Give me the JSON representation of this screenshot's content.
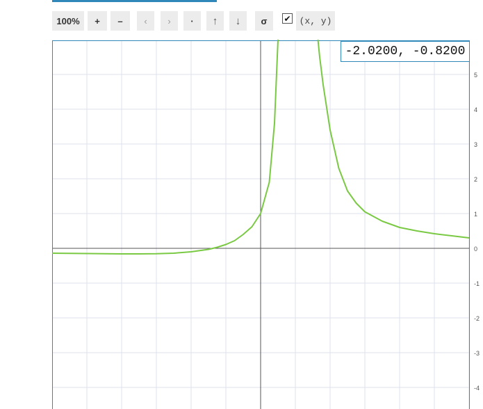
{
  "toolbar": {
    "zoom_label": "100%",
    "zoom_in_label": "+",
    "zoom_out_label": "–",
    "pan_left_label": "‹",
    "pan_right_label": "›",
    "center_label": "·",
    "pan_up_label": "↑",
    "pan_down_label": "↓",
    "trace_label": "σ",
    "coords_checked": true,
    "coords_check_mark": "✔",
    "coords_label": "(x, y)"
  },
  "readout": {
    "text": "-2.0200, -0.8200"
  },
  "chart_data": {
    "type": "line",
    "title": "",
    "xlabel": "",
    "ylabel": "",
    "xlim": [
      -6,
      6
    ],
    "ylim": [
      -4.5,
      6
    ],
    "grid": true,
    "x_tick_labels": [],
    "y_tick_labels": [
      "5",
      "4",
      "3",
      "2",
      "1",
      "0",
      "-1",
      "-2",
      "-3",
      "-4"
    ],
    "y_tick_values": [
      5,
      4,
      3,
      2,
      1,
      0,
      -1,
      -2,
      -3,
      -4
    ],
    "series": [
      {
        "color": "#7ac943",
        "segments": [
          {
            "x": [
              -6,
              -5,
              -4.5,
              -4,
              -3.5,
              -3,
              -2.5,
              -2,
              -1.5,
              -1.25,
              -1,
              -0.75,
              -0.5,
              -0.25,
              0,
              0.25,
              0.4,
              0.5
            ],
            "y": [
              -0.14,
              -0.15,
              -0.155,
              -0.16,
              -0.16,
              -0.155,
              -0.14,
              -0.1,
              -0.03,
              0.03,
              0.11,
              0.22,
              0.4,
              0.62,
              1,
              1.9,
              3.6,
              6
            ]
          },
          {
            "x": [
              1.65,
              1.7,
              1.8,
              2,
              2.25,
              2.5,
              2.75,
              3,
              3.5,
              4,
              4.5,
              5,
              5.5,
              6
            ],
            "y": [
              6,
              5.5,
              4.7,
              3.4,
              2.3,
              1.65,
              1.3,
              1.05,
              0.78,
              0.6,
              0.5,
              0.42,
              0.36,
              0.3
            ]
          }
        ]
      }
    ]
  }
}
